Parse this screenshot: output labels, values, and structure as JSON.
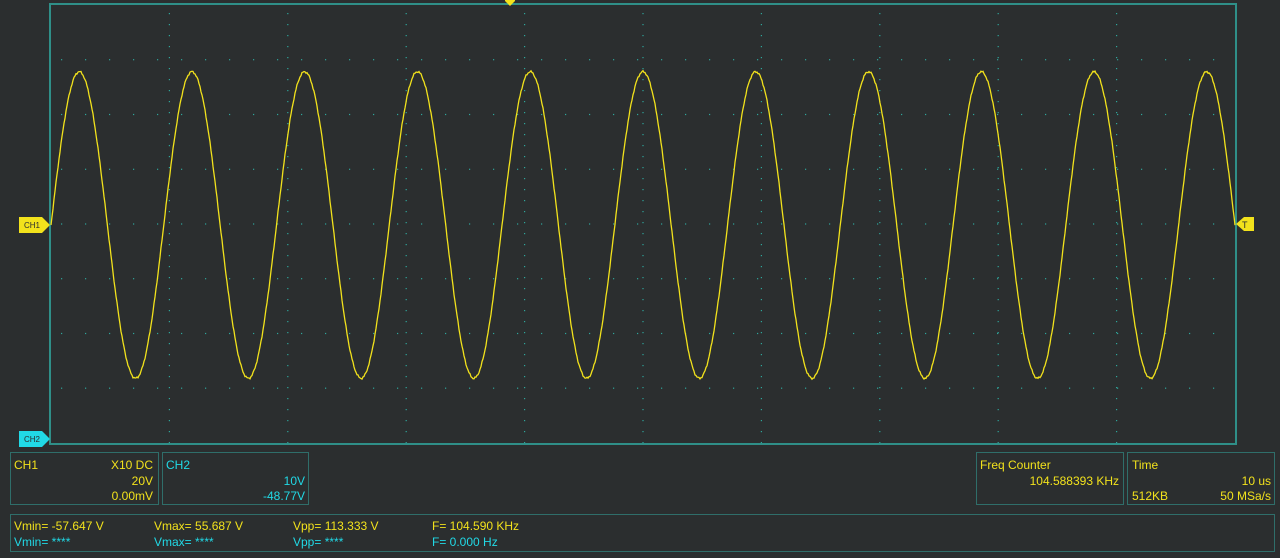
{
  "colors": {
    "background": "#2b2e2f",
    "grid_border": "#2f8f88",
    "grid_dots": "#2fa59b",
    "ch1": "#f2e21c",
    "ch2": "#21d9e6"
  },
  "markers": {
    "ch1_label": "CH1",
    "ch2_label": "CH2",
    "trigger_label": "T"
  },
  "ch1_panel": {
    "title": "CH1",
    "probe_coupling": "X10  DC",
    "volts_per_div": "20V",
    "offset": "0.00mV"
  },
  "ch2_panel": {
    "title": "CH2",
    "volts_per_div": "10V",
    "offset": "-48.77V"
  },
  "freq_panel": {
    "title": "Freq Counter",
    "value": "104.588393 KHz"
  },
  "time_panel": {
    "title": "Time",
    "time_per_div": "10 us",
    "memory_depth": "512KB",
    "sample_rate": "50 MSa/s"
  },
  "measurements": {
    "ch1": {
      "vmin": "Vmin= -57.647 V",
      "vmax": "Vmax= 55.687 V",
      "vpp": "Vpp= 113.333 V",
      "freq": "F= 104.590 KHz"
    },
    "ch2": {
      "vmin": "Vmin= ****",
      "vmax": "Vmax= ****",
      "vpp": "Vpp= ****",
      "freq": "F= 0.000 Hz"
    }
  },
  "chart_data": {
    "type": "line",
    "series": [
      {
        "waveform": "sine",
        "cycles_on_screen": 10.5,
        "peak_divisions": 2.8,
        "start_phase_deg": 0
      }
    ],
    "grid": true,
    "divisions_x": 10,
    "divisions_y": 8
  }
}
